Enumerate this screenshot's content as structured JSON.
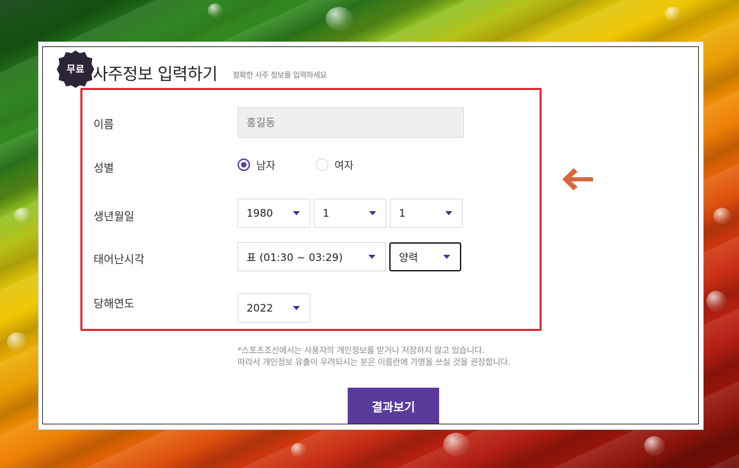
{
  "header": {
    "badge": "무료",
    "title": "사주정보 입력하기",
    "subtitle": "정확한 사주 정보를 입력하세요"
  },
  "form": {
    "name": {
      "label": "이름",
      "placeholder": "홍길동"
    },
    "gender": {
      "label": "성별",
      "options": [
        "남자",
        "여자"
      ],
      "selected": "남자"
    },
    "birthdate": {
      "label": "생년월일",
      "year": "1980",
      "month": "1",
      "day": "1"
    },
    "birthtime": {
      "label": "태어난시각",
      "time": "표 (01:30 ~ 03:29)",
      "calendar": "양력"
    },
    "current_year": {
      "label": "당해연도",
      "year": "2022"
    }
  },
  "notice": {
    "line1": "*스포츠조선에서는 사용자의 개인정보를 받거나 저장하지 않고 있습니다.",
    "line2": "따라서 개인정보 유출이 우려되시는 분은 이름란에 가명을 쓰실 것을 권장합니다."
  },
  "submit_label": "결과보기",
  "colors": {
    "accent": "#5a3a9b",
    "highlight_box": "#e22a32",
    "arrow": "#d9663f",
    "badge": "#2d2438"
  }
}
